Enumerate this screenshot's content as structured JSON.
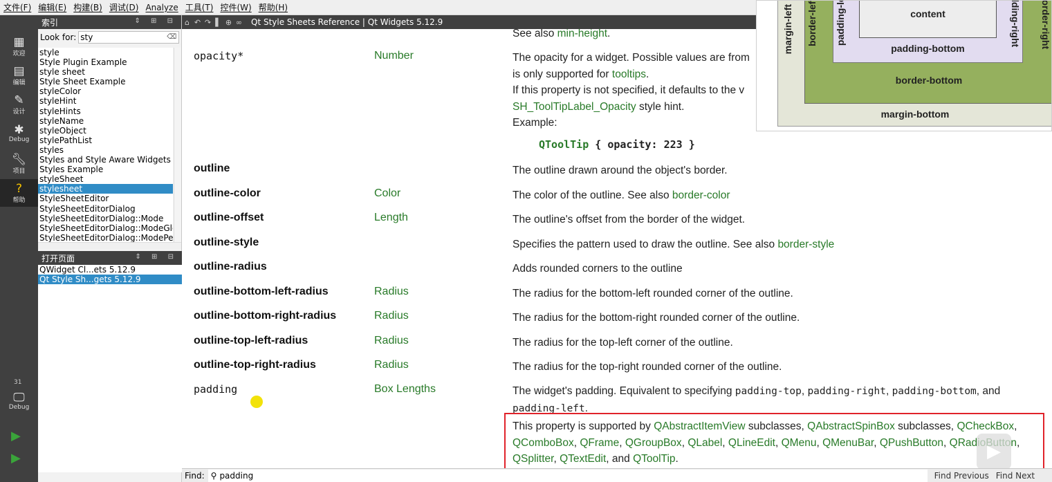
{
  "menubar": [
    "文件(F)",
    "编辑(E)",
    "构建(B)",
    "调试(D)",
    "Analyze",
    "工具(T)",
    "控件(W)",
    "帮助(H)"
  ],
  "modes": {
    "welcome": "欢迎",
    "edit": "编辑",
    "design": "设计",
    "debug": "Debug",
    "project": "项目",
    "help": "帮助",
    "kit_number": "31",
    "kit_debug": "Debug"
  },
  "index_panel": {
    "title": "索引",
    "look_for_label": "Look for:",
    "look_for_value": "sty",
    "items": [
      "style",
      "Style Plugin Example",
      "style sheet",
      "Style Sheet Example",
      "styleColor",
      "styleHint",
      "styleHints",
      "styleName",
      "styleObject",
      "stylePathList",
      "styles",
      "Styles and Style Aware Widgets",
      "Styles Example",
      "styleSheet",
      "stylesheet",
      "StyleSheetEditor",
      "StyleSheetEditorDialog",
      "StyleSheetEditorDialog::Mode",
      "StyleSheetEditorDialog::ModeGlob",
      "StyleSheetEditorDialog::ModePerF"
    ],
    "selected_index": 14
  },
  "open_pages": {
    "title": "打开页面",
    "items": [
      "QWidget Cl...ets 5.12.9",
      "Qt Style Sh...gets 5.12.9"
    ],
    "selected_index": 1
  },
  "toolbar": {
    "title": "Qt Style Sheets Reference | Qt Widgets 5.12.9"
  },
  "doc": {
    "top_line": {
      "text": "See also ",
      "link": "min-height",
      "suffix": "."
    },
    "opacity": {
      "name": "opacity*",
      "type": "Number",
      "line1_a": "The opacity for a widget. Possible values are from",
      "line2_a": "is only supported for ",
      "line2_link": "tooltips",
      "line2_b": ".",
      "line3": "If this property is not specified, it defaults to the v",
      "line4_link": "SH_ToolTipLabel_Opacity",
      "line4_b": " style hint.",
      "line5": "Example:",
      "code_sel": "QToolTip",
      "code_rest": " { opacity: 223 }"
    },
    "rows": [
      {
        "name": "outline",
        "type": "",
        "desc": "The outline drawn around the object's border.",
        "link": ""
      },
      {
        "name": "outline-color",
        "type": "Color",
        "desc": "The color of the outline. See also ",
        "link": "border-color"
      },
      {
        "name": "outline-offset",
        "type": "Length",
        "desc": "The outline's offset from the border of the widget.",
        "link": ""
      },
      {
        "name": "outline-style",
        "type": "",
        "desc": "Specifies the pattern used to draw the outline. See also ",
        "link": "border-style"
      },
      {
        "name": "outline-radius",
        "type": "",
        "desc": "Adds rounded corners to the outline",
        "link": ""
      },
      {
        "name": "outline-bottom-left-radius",
        "type": "Radius",
        "desc": "The radius for the bottom-left rounded corner of the outline.",
        "link": ""
      },
      {
        "name": "outline-bottom-right-radius",
        "type": "Radius",
        "desc": "The radius for the bottom-right rounded corner of the outline.",
        "link": ""
      },
      {
        "name": "outline-top-left-radius",
        "type": "Radius",
        "desc": "The radius for the top-left corner of the outline.",
        "link": ""
      },
      {
        "name": "outline-top-right-radius",
        "type": "Radius",
        "desc": "The radius for the top-right rounded corner of the outline.",
        "link": ""
      }
    ],
    "padding": {
      "name": "padding",
      "type": "Box Lengths",
      "l1a": "The widget's padding. Equivalent to specifying ",
      "c1": "padding-top",
      "s1": ", ",
      "c2": "padding-right",
      "s2": ", ",
      "c3": "padding-bottom",
      "s3": ", and",
      "c4": "padding-left",
      "s4": ".",
      "support_a": "This property is supported by ",
      "links": [
        "QAbstractItemView",
        "QAbstractSpinBox",
        "QCheckBox",
        "QComboBox",
        "QFrame",
        "QGroupBox",
        "QLabel",
        "QLineEdit",
        "QMenu",
        "QMenuBar",
        "QPushButton",
        "QRadioButton",
        "QSplitter",
        "QTextEdit",
        "QToolTip"
      ],
      "word_subclasses": " subclasses, ",
      "word_and": ", and "
    }
  },
  "box_model": {
    "content": "content",
    "margin_left": "margin-left",
    "border_left": "border-left",
    "padding_left": "padding-left",
    "padding_right": "padding-right",
    "border_right": "border-right",
    "padding_bottom": "padding-bottom",
    "border_bottom": "border-bottom",
    "margin_bottom": "margin-bottom"
  },
  "findbar": {
    "label": "Find:",
    "value": "padding",
    "prev": "Find Previous",
    "next": "Find Next"
  },
  "colors": {
    "link_green": "#287a28",
    "selection_blue": "#308cc6",
    "highlight_red": "#e0222a"
  }
}
